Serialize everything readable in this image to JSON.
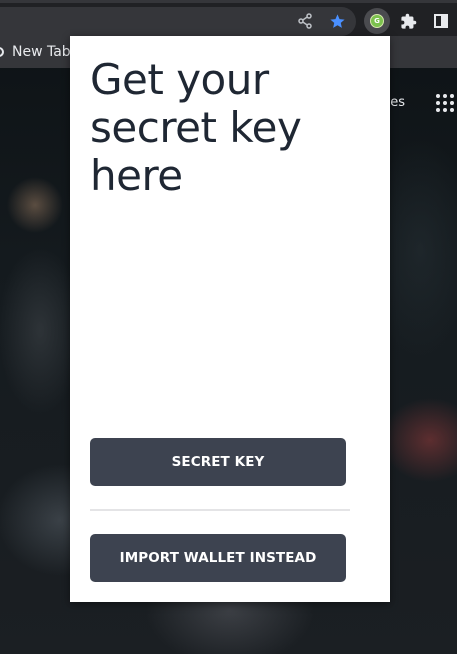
{
  "browser": {
    "toolbar_icons": {
      "share": "share-icon",
      "bookmark": "star-icon",
      "extension_active": "extension-logo-icon",
      "extensions": "puzzle-icon",
      "side_panel": "side-panel-icon"
    },
    "extension_logo_text": "G",
    "bookmark_bar": {
      "item_label": "New Tab"
    },
    "accent_color": "#4a90ff"
  },
  "new_tab_page": {
    "link_fragment": "ges"
  },
  "popup": {
    "title": "Get your secret key here",
    "primary_button_label": "SECRET KEY",
    "secondary_button_label": "IMPORT WALLET INSTEAD",
    "button_color": "#3d4350",
    "title_color": "#1f2733"
  }
}
